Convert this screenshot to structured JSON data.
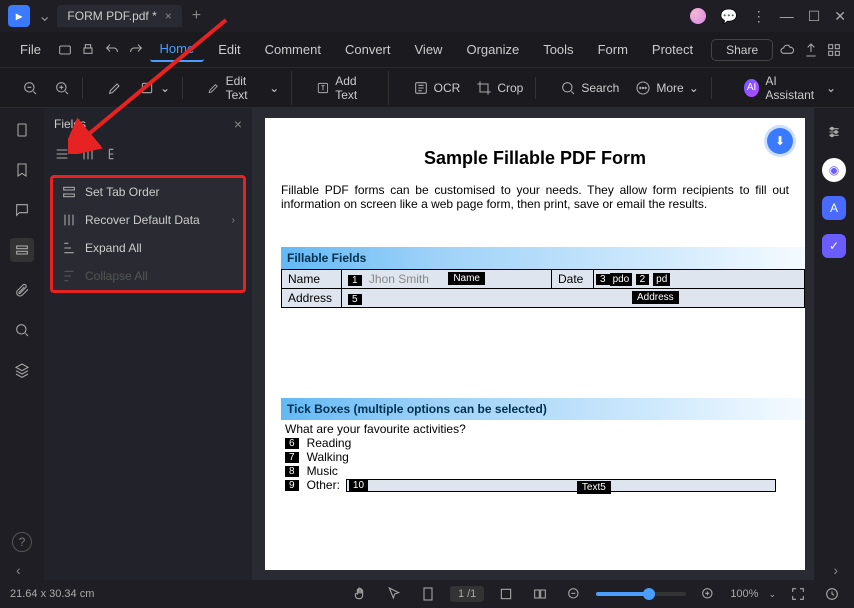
{
  "titlebar": {
    "tab_name": "FORM PDF.pdf *"
  },
  "menubar": {
    "file": "File",
    "items": [
      "Home",
      "Edit",
      "Comment",
      "Convert",
      "View",
      "Organize",
      "Tools",
      "Form",
      "Protect"
    ],
    "active_index": 0,
    "share": "Share"
  },
  "toolbar": {
    "edit_text": "Edit Text",
    "add_text": "Add Text",
    "ocr": "OCR",
    "crop": "Crop",
    "search": "Search",
    "more": "More",
    "ai": "AI Assistant"
  },
  "side_panel": {
    "title": "Fields",
    "context": {
      "set_tab_order": "Set Tab Order",
      "recover_default": "Recover Default Data",
      "expand_all": "Expand All",
      "collapse_all": "Collapse All"
    }
  },
  "document": {
    "title": "Sample Fillable PDF Form",
    "description": "Fillable PDF forms can be customised to your needs. They allow form recipients to fill out information on screen like a web page form, then print, save or email the results.",
    "section_fillable": "Fillable Fields",
    "fields": {
      "name_label": "Name",
      "name_tab": "1",
      "name_placeholder": "Jhon Smith",
      "name_badge": "Name",
      "date_label": "Date",
      "date_tab": "3",
      "date_val1": "pdo",
      "date_tab2": "2",
      "date_val2": "pd",
      "address_label": "Address",
      "address_tab": "5",
      "address_badge": "Address"
    },
    "section_tick": "Tick Boxes (multiple options can be selected)",
    "tick_question": "What are your favourite activities?",
    "ticks": [
      {
        "num": "6",
        "label": "Reading"
      },
      {
        "num": "7",
        "label": "Walking"
      },
      {
        "num": "8",
        "label": "Music"
      }
    ],
    "other": {
      "num": "9",
      "label": "Other:",
      "field_tab": "10",
      "field_badge": "Text5"
    }
  },
  "statusbar": {
    "dimensions": "21.64 x 30.34 cm",
    "page": "1 /1",
    "zoom": "100%"
  }
}
